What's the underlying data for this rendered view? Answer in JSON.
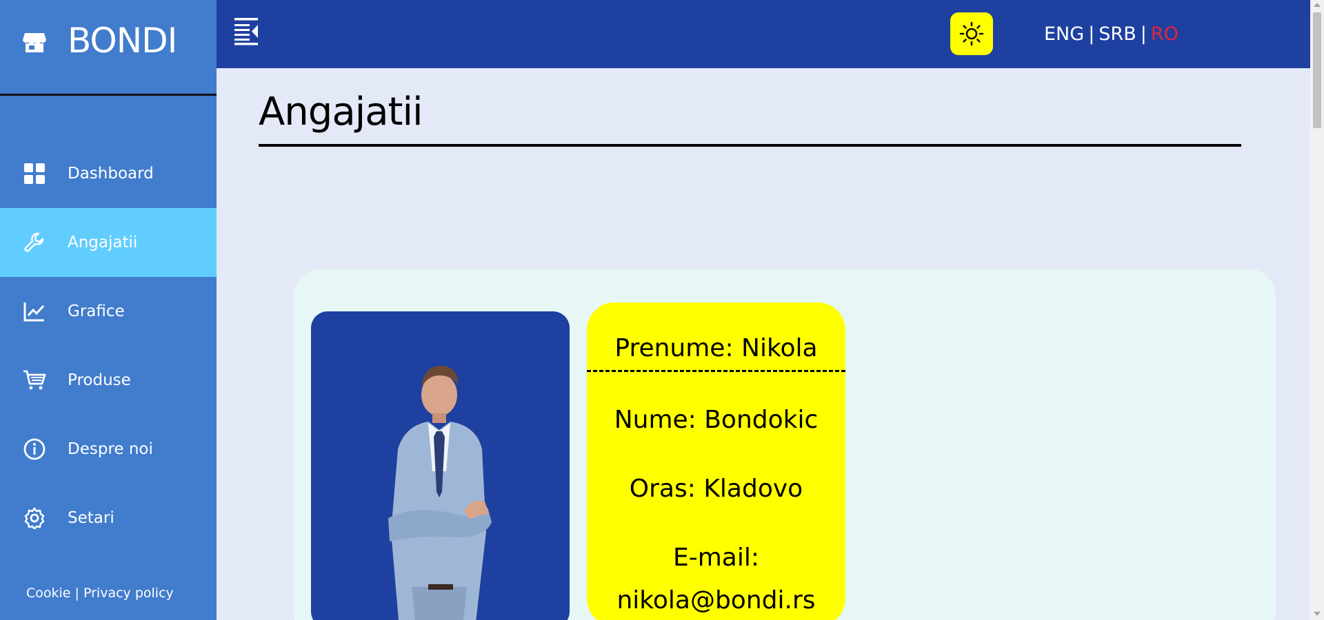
{
  "brand": {
    "name": "BONDI"
  },
  "sidebar": {
    "items": [
      {
        "label": "Dashboard",
        "icon": "grid-icon",
        "active": false
      },
      {
        "label": "Angajatii",
        "icon": "wrench-icon",
        "active": true
      },
      {
        "label": "Grafice",
        "icon": "chart-line-icon",
        "active": false
      },
      {
        "label": "Produse",
        "icon": "cart-icon",
        "active": false
      },
      {
        "label": "Despre noi",
        "icon": "info-icon",
        "active": false
      },
      {
        "label": "Setari",
        "icon": "gear-icon",
        "active": false
      }
    ],
    "footer": {
      "cookie": "Cookie",
      "separator": "|",
      "privacy": "Privacy policy"
    }
  },
  "topbar": {
    "theme_icon": "sun-icon",
    "languages": [
      "ENG",
      "SRB",
      "RO"
    ],
    "active_language": "RO"
  },
  "main": {
    "title": "Angajatii",
    "employee": {
      "first_name": "Prenume: Nikola",
      "last_name": "Nume: Bondokic",
      "city": "Oras: Kladovo",
      "email_label": "E-mail:",
      "email": "nikola@bondi.rs"
    }
  },
  "colors": {
    "sidebar": "#417ccd",
    "sidebar_active": "#61cdff",
    "topbar": "#1e40a0",
    "page_bg": "#e3e9f6",
    "panel_bg": "#e6f7f6",
    "info_card": "#ffff00",
    "active_language": "#e8233a"
  }
}
